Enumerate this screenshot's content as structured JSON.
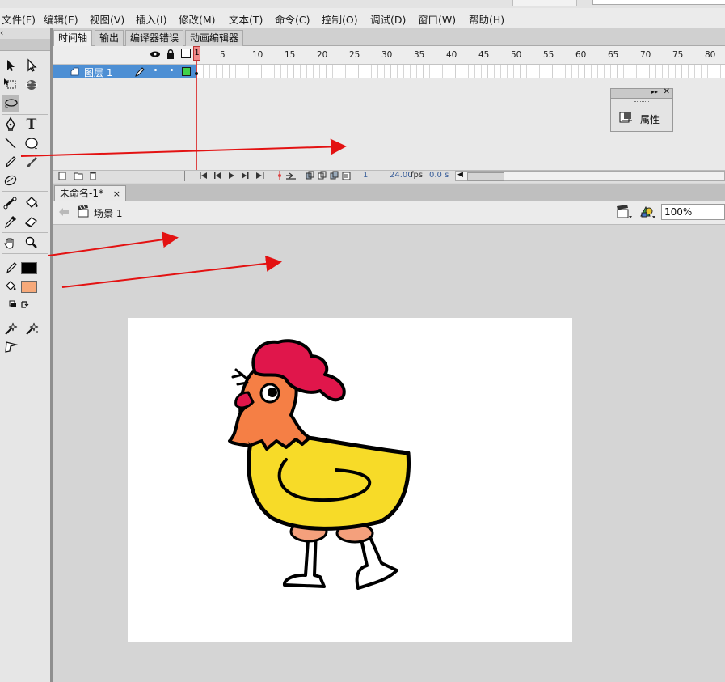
{
  "menu": {
    "items": [
      "文件(F)",
      "编辑(E)",
      "视图(V)",
      "插入(I)",
      "修改(M)",
      "文本(T)",
      "命令(C)",
      "控制(O)",
      "调试(D)",
      "窗口(W)",
      "帮助(H)"
    ]
  },
  "toolbox": {
    "title": "‹"
  },
  "panel_tabs": [
    "时间轴",
    "输出",
    "编译器错误",
    "动画编辑器"
  ],
  "timeline": {
    "ruler": [
      "1",
      "5",
      "10",
      "15",
      "20",
      "25",
      "30",
      "35",
      "40",
      "45",
      "50",
      "55",
      "60",
      "65",
      "70",
      "75",
      "80"
    ],
    "layer_name": "图层 1",
    "current_frame": "1",
    "fps": "24.00",
    "fps_unit": "fps",
    "elapsed": "0.0 s"
  },
  "properties_panel": {
    "label": "属性"
  },
  "document": {
    "tab_title": "未命名-1*",
    "tab_close": "×",
    "scene_name": "场景 1",
    "zoom": "100%"
  },
  "colors": {
    "stroke": "#000000",
    "fill": "#f6a97a",
    "arrow": "#e31212",
    "layer_highlight": "#4d8fd4"
  },
  "icons": [
    "selection-tool-icon",
    "subselection-tool-icon",
    "free-transform-icon",
    "3d-rotation-icon",
    "lasso-icon",
    "pen-icon",
    "text-icon",
    "line-icon",
    "oval-icon",
    "pencil-icon",
    "brush-icon",
    "deco-icon",
    "bone-icon",
    "paint-bucket-icon",
    "eyedropper-icon",
    "eraser-icon",
    "hand-icon",
    "zoom-icon",
    "stroke-color-icon",
    "fill-color-icon",
    "swap-colors-icon",
    "snap-icon",
    "smooth-icon",
    "straighten-icon"
  ]
}
